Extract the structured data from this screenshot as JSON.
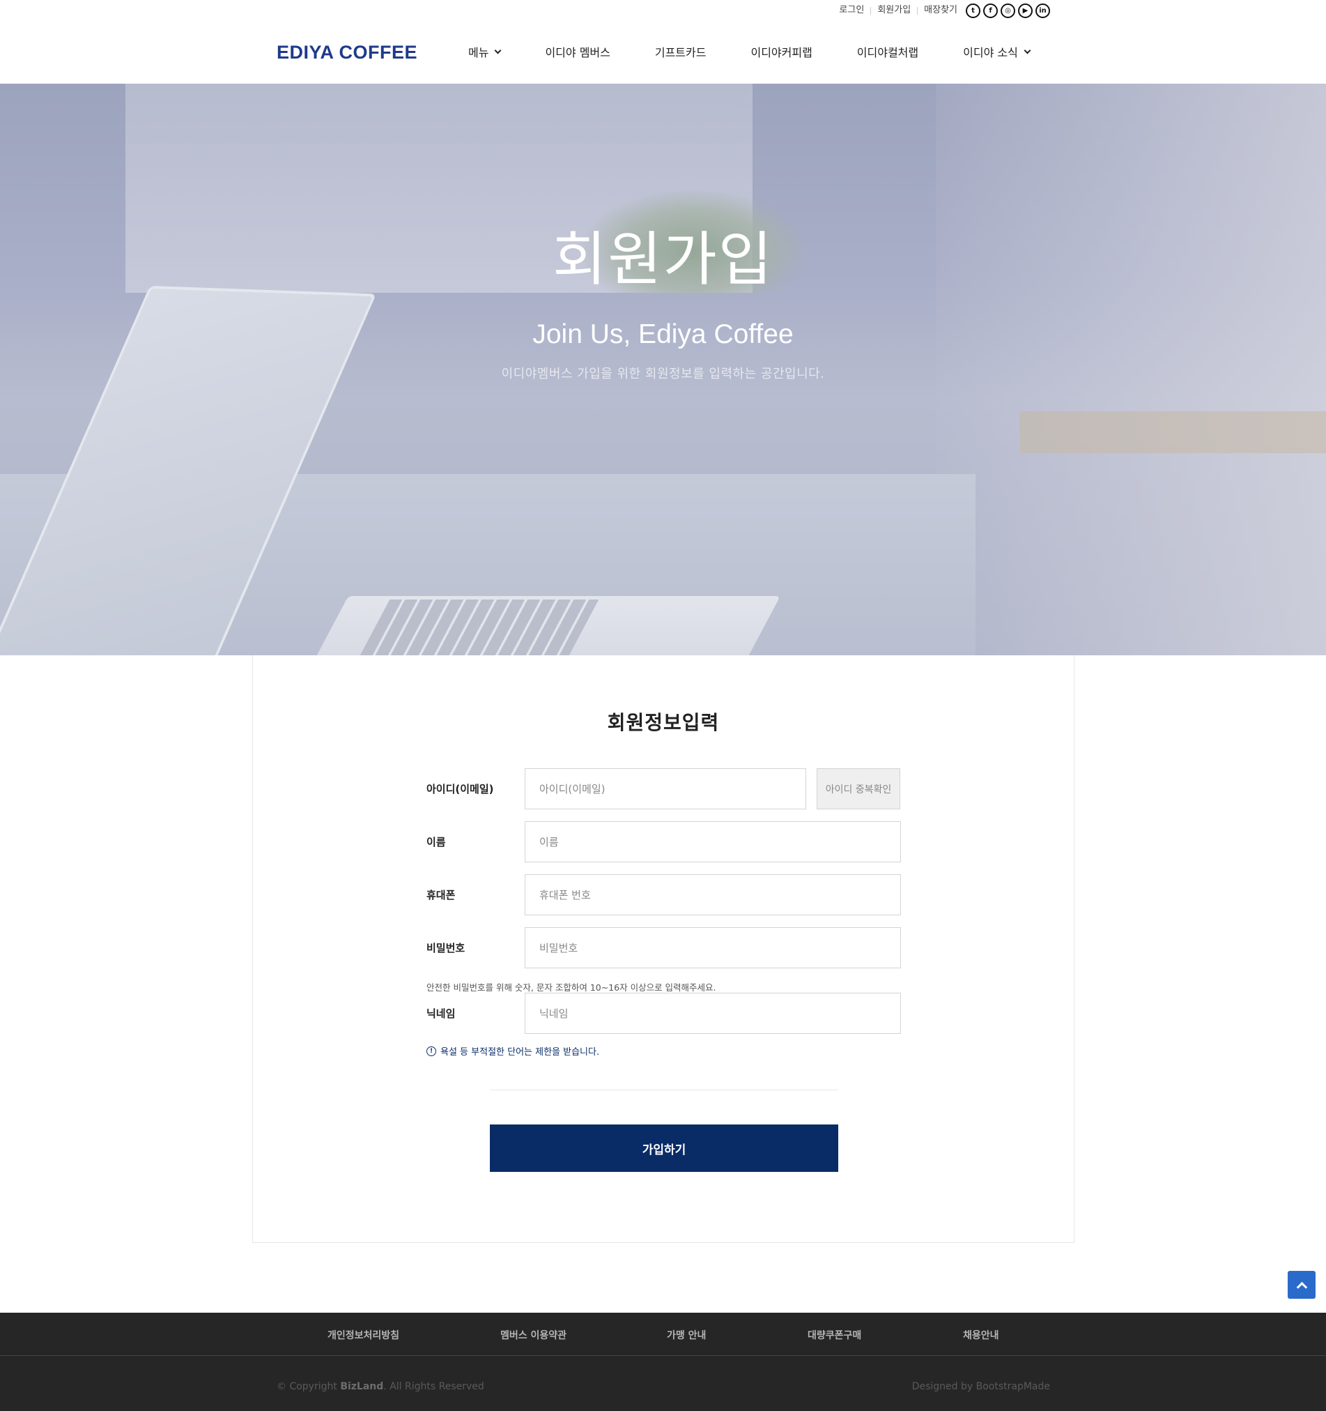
{
  "topbar": {
    "links": [
      "로그인",
      "회원가입",
      "매장찾기"
    ],
    "socials": [
      {
        "name": "twitter-icon",
        "glyph": "t"
      },
      {
        "name": "facebook-icon",
        "glyph": "f"
      },
      {
        "name": "instagram-icon",
        "glyph": "◎"
      },
      {
        "name": "youtube-icon",
        "glyph": "▶"
      },
      {
        "name": "linkedin-icon",
        "glyph": "in"
      }
    ]
  },
  "header": {
    "logo": "EDIYA COFFEE",
    "nav": [
      {
        "label": "메뉴",
        "dropdown": true
      },
      {
        "label": "이디야 멤버스",
        "dropdown": false
      },
      {
        "label": "기프트카드",
        "dropdown": false
      },
      {
        "label": "이디야커피랩",
        "dropdown": false
      },
      {
        "label": "이디야컬처랩",
        "dropdown": false
      },
      {
        "label": "이디야 소식",
        "dropdown": true
      }
    ]
  },
  "hero": {
    "title": "회원가입",
    "subtitle": "Join Us, Ediya Coffee",
    "description": "이디야멤버스 가입을 위한 회원정보를 입력하는 공간입니다."
  },
  "form": {
    "title": "회원정보입력",
    "id_label": "아이디(이메일)",
    "id_placeholder": "아이디(이메일)",
    "id_check_button": "아이디 중복확인",
    "name_label": "이름",
    "name_placeholder": "이름",
    "phone_label": "휴대폰",
    "phone_placeholder": "휴대폰 번호",
    "password_label": "비밀번호",
    "password_placeholder": "비밀번호",
    "password_hint": "안전한 비밀번호를 위해 숫자, 문자 조합하여 10~16자 이상으로 입력해주세요.",
    "nickname_label": "닉네임",
    "nickname_placeholder": "닉네임",
    "nickname_warning": "욕설 등 부적절한 단어는 제한을 받습니다.",
    "submit": "가입하기"
  },
  "footer": {
    "links": [
      "개인정보처리방침",
      "멤버스 이용약관",
      "가맹 안내",
      "대량쿠폰구매",
      "채용안내"
    ],
    "copyright_prefix": "© Copyright ",
    "copyright_brand": "BizLand",
    "copyright_suffix": ". All Rights Reserved",
    "designed_by": "Designed by BootstrapMade"
  },
  "colors": {
    "brand": "#1f3a8a",
    "submit": "#0a2c66",
    "footer": "#262626",
    "to_top": "#2a6acb"
  }
}
